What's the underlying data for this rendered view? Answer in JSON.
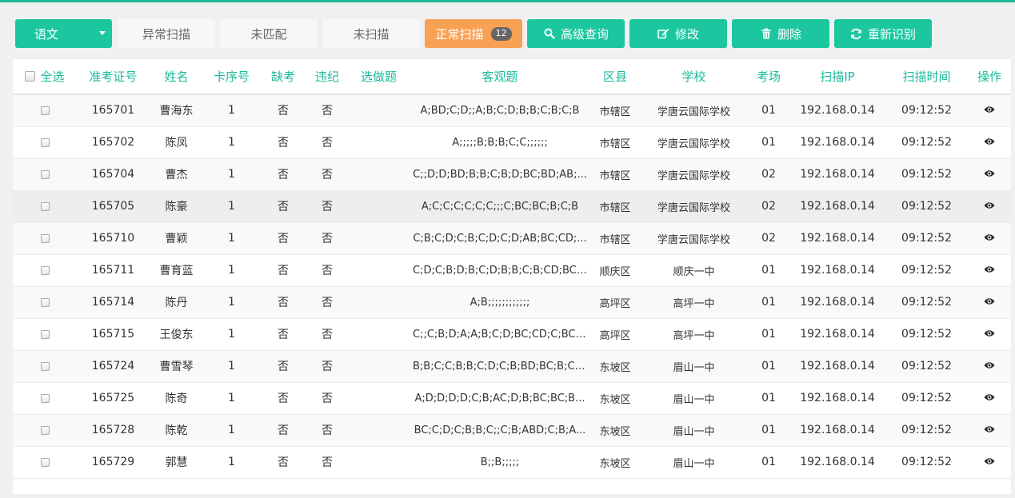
{
  "toolbar": {
    "subject": "语文",
    "tabs": [
      "异常扫描",
      "未匹配",
      "未扫描"
    ],
    "active_tab": "正常扫描",
    "active_count": "12",
    "advanced_query": "高级查询",
    "edit": "修改",
    "delete": "删除",
    "rerecognize": "重新识别"
  },
  "colors": {
    "accent": "#1cc79f",
    "active_tab": "#f8a155",
    "header_text": "#1cb99a"
  },
  "table": {
    "headers": {
      "select_all": "全选",
      "exam_id": "准考证号",
      "name": "姓名",
      "card_no": "卡序号",
      "absent": "缺考",
      "violation": "违纪",
      "optional": "选做题",
      "objective": "客观题",
      "district": "区县",
      "school": "学校",
      "room": "考场",
      "ip": "扫描IP",
      "time": "扫描时间",
      "action": "操作"
    },
    "rows": [
      {
        "exam_id": "165701",
        "name": "曹海东",
        "card_no": "1",
        "absent": "否",
        "violation": "否",
        "optional": "",
        "objective": "A;BD;C;D;;A;B;C;D;B;B;C;B;C;B",
        "district": "市辖区",
        "school": "学唐云国际学校",
        "room": "01",
        "ip": "192.168.0.14",
        "time": "09:12:52"
      },
      {
        "exam_id": "165702",
        "name": "陈凤",
        "card_no": "1",
        "absent": "否",
        "violation": "否",
        "optional": "",
        "objective": "A;;;;;B;B;B;C;C;;;;;;",
        "district": "市辖区",
        "school": "学唐云国际学校",
        "room": "01",
        "ip": "192.168.0.14",
        "time": "09:12:52"
      },
      {
        "exam_id": "165704",
        "name": "曹杰",
        "card_no": "1",
        "absent": "否",
        "violation": "否",
        "optional": "",
        "objective": "C;;D;D;BD;B;B;C;B;D;BC;BD;AB;...",
        "district": "市辖区",
        "school": "学唐云国际学校",
        "room": "02",
        "ip": "192.168.0.14",
        "time": "09:12:52"
      },
      {
        "exam_id": "165705",
        "name": "陈豪",
        "card_no": "1",
        "absent": "否",
        "violation": "否",
        "optional": "",
        "objective": "A;C;C;C;C;C;C;;;C;BC;BC;B;C;B",
        "district": "市辖区",
        "school": "学唐云国际学校",
        "room": "02",
        "ip": "192.168.0.14",
        "time": "09:12:52"
      },
      {
        "exam_id": "165710",
        "name": "曹颖",
        "card_no": "1",
        "absent": "否",
        "violation": "否",
        "optional": "",
        "objective": "C;B;C;D;C;B;C;D;C;D;AB;BC;CD;...",
        "district": "市辖区",
        "school": "学唐云国际学校",
        "room": "02",
        "ip": "192.168.0.14",
        "time": "09:12:52"
      },
      {
        "exam_id": "165711",
        "name": "曹育蓝",
        "card_no": "1",
        "absent": "否",
        "violation": "否",
        "optional": "",
        "objective": "C;D;C;B;D;B;C;D;B;B;C;B;CD;BC;C",
        "district": "顺庆区",
        "school": "顺庆一中",
        "room": "01",
        "ip": "192.168.0.14",
        "time": "09:12:52"
      },
      {
        "exam_id": "165714",
        "name": "陈丹",
        "card_no": "1",
        "absent": "否",
        "violation": "否",
        "optional": "",
        "objective": "A;B;;;;;;;;;;;;",
        "district": "高坪区",
        "school": "高坪一中",
        "room": "01",
        "ip": "192.168.0.14",
        "time": "09:12:52"
      },
      {
        "exam_id": "165715",
        "name": "王俊东",
        "card_no": "1",
        "absent": "否",
        "violation": "否",
        "optional": "",
        "objective": "C;;C;B;D;A;A;B;C;D;BC;CD;C;BC;...",
        "district": "高坪区",
        "school": "高坪一中",
        "room": "01",
        "ip": "192.168.0.14",
        "time": "09:12:52"
      },
      {
        "exam_id": "165724",
        "name": "曹雪琴",
        "card_no": "1",
        "absent": "否",
        "violation": "否",
        "optional": "",
        "objective": "B;B;C;C;B;B;C;D;C;B;BD;BC;B;CD...",
        "district": "东坡区",
        "school": "眉山一中",
        "room": "01",
        "ip": "192.168.0.14",
        "time": "09:12:52"
      },
      {
        "exam_id": "165725",
        "name": "陈奇",
        "card_no": "1",
        "absent": "否",
        "violation": "否",
        "optional": "",
        "objective": "A;D;D;D;D;C;B;AC;D;B;BC;BC;B...",
        "district": "东坡区",
        "school": "眉山一中",
        "room": "01",
        "ip": "192.168.0.14",
        "time": "09:12:52"
      },
      {
        "exam_id": "165728",
        "name": "陈乾",
        "card_no": "1",
        "absent": "否",
        "violation": "否",
        "optional": "",
        "objective": "BC;C;D;C;B;B;C;;C;B;ABD;C;B;A...",
        "district": "东坡区",
        "school": "眉山一中",
        "room": "01",
        "ip": "192.168.0.14",
        "time": "09:12:52"
      },
      {
        "exam_id": "165729",
        "name": "郭慧",
        "card_no": "1",
        "absent": "否",
        "violation": "否",
        "optional": "",
        "objective": "B;;B;;;;;",
        "district": "东坡区",
        "school": "眉山一中",
        "room": "01",
        "ip": "192.168.0.14",
        "time": "09:12:52"
      }
    ]
  }
}
